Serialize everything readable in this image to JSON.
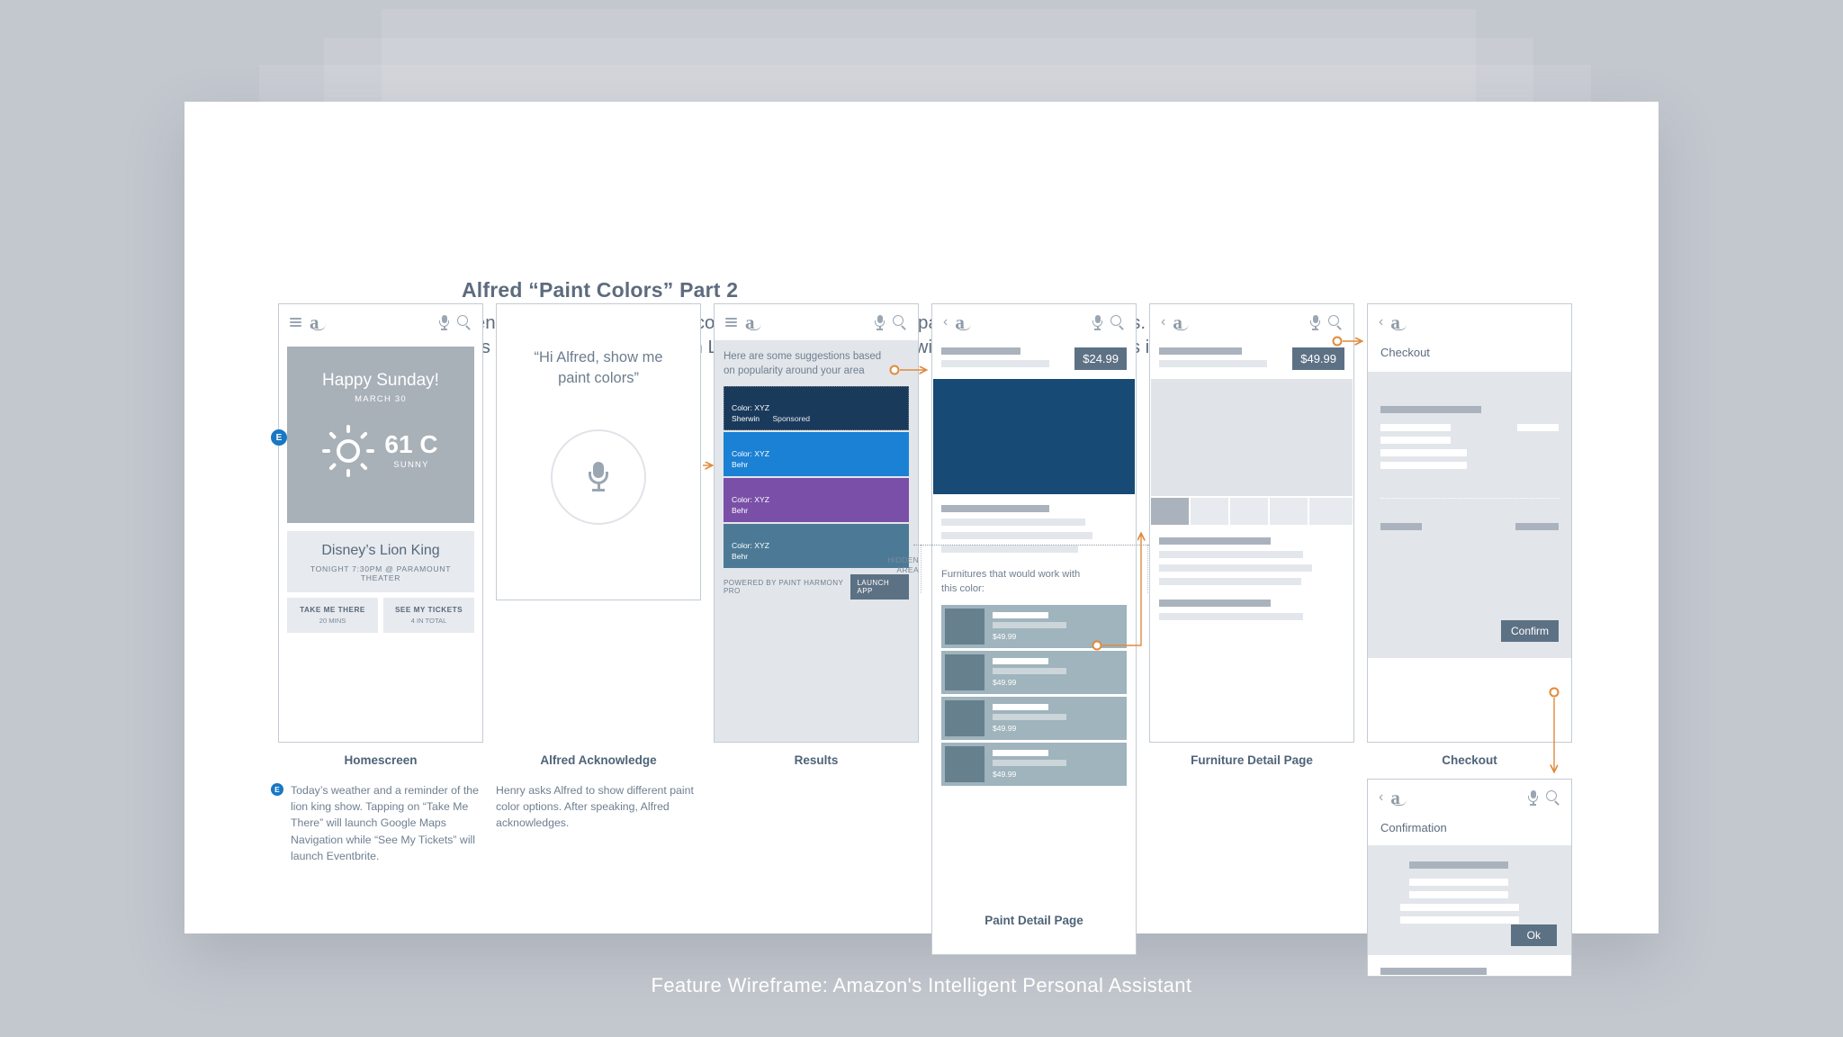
{
  "footer": {
    "text": "Feature Wireframe: Amazon's Intelligent Personal Assistant"
  },
  "header": {
    "title": "Alfred “Paint Colors” Part 2",
    "subtitle_line1": "Henry wants to see some decor ideas. He wants to see paints and furniture options.",
    "subtitle_line2": "It is Sunday AM, relaxing with Lion King show to attend with his family at night. This is what he sees on Alfred:"
  },
  "icons": {
    "hamburger": "hamburger-icon",
    "amazon": "amazon-logo",
    "mic": "microphone-icon",
    "search": "search-icon",
    "back": "‹"
  },
  "screens": {
    "homescreen": {
      "caption": "Homescreen",
      "badge": "E",
      "note": "Today’s weather and a reminder of the lion king show. Tapping on “Take Me There” will launch Google Maps Navigation while “See My Tickets” will launch Eventbrite.",
      "weather": {
        "greeting": "Happy Sunday!",
        "date": "MARCH 30",
        "temperature": "61 C",
        "condition": "SUNNY"
      },
      "event": {
        "title": "Disney’s Lion King",
        "subtitle": "TONIGHT 7:30PM @ PARAMOUNT THEATER",
        "buttons": [
          {
            "label": "TAKE ME THERE",
            "sub": "20 MINS"
          },
          {
            "label": "SEE MY TICKETS",
            "sub": "4 IN TOTAL"
          }
        ]
      }
    },
    "acknowledge": {
      "caption": "Alfred Acknowledge",
      "quote_line1": "“Hi Alfred, show me",
      "quote_line2": "paint colors”",
      "note": "Henry asks Alfred to show different paint color options. After speaking, Alfred acknowledges."
    },
    "results": {
      "caption": "Results",
      "hint_line1": "Here are some suggestions based",
      "hint_line2": "on popularity around your area",
      "swatches": [
        {
          "name": "Color: XYZ",
          "brand": "Sherwin",
          "tag": "Sponsored",
          "color": "#1a3a5c",
          "selected": true
        },
        {
          "name": "Color: XYZ",
          "brand": "Behr",
          "tag": "",
          "color": "#1b81d4",
          "selected": false
        },
        {
          "name": "Color: XYZ",
          "brand": "Behr",
          "tag": "",
          "color": "#7a4fa8",
          "selected": false
        },
        {
          "name": "Color: XYZ",
          "brand": "Behr",
          "tag": "",
          "color": "#4c7a96",
          "selected": false
        }
      ],
      "powered_by": "POWERED BY PAINT HARMONY PRO",
      "launch_label": "LAUNCH APP"
    },
    "paint_detail": {
      "caption": "Paint Detail Page",
      "price": "$24.99",
      "hero_color": "#174a74",
      "furniture_hint_line1": "Furnitures that would work with",
      "furniture_hint_line2": "this color:",
      "furniture": [
        {
          "price": "$49.99"
        },
        {
          "price": "$49.99"
        },
        {
          "price": "$49.99"
        },
        {
          "price": "$49.99"
        }
      ],
      "hidden_area_line1": "HIDDEN",
      "hidden_area_line2": "AREA"
    },
    "furniture_detail": {
      "caption": "Furniture Detail Page",
      "price": "$49.99"
    },
    "checkout": {
      "caption": "Checkout",
      "page_label": "Checkout",
      "confirm_label": "Confirm"
    },
    "confirmation": {
      "page_label": "Confirmation",
      "ok_label": "Ok"
    }
  },
  "colors": {
    "accent_connector": "#e08a3c",
    "badge_blue": "#1878c4",
    "text_heading": "#5d6b7e",
    "page_background": "#c3c7ce"
  }
}
